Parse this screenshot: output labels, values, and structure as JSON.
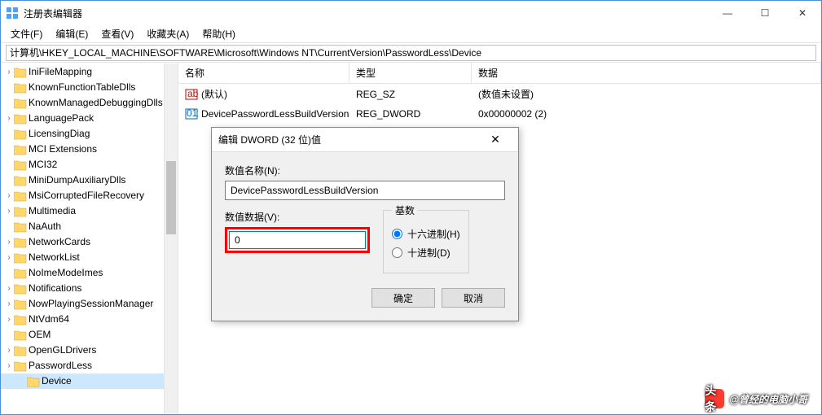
{
  "window": {
    "title": "注册表编辑器",
    "controls": {
      "min": "—",
      "max": "☐",
      "close": "✕"
    }
  },
  "menu": {
    "file": "文件(F)",
    "edit": "编辑(E)",
    "view": "查看(V)",
    "fav": "收藏夹(A)",
    "help": "帮助(H)"
  },
  "path": "计算机\\HKEY_LOCAL_MACHINE\\SOFTWARE\\Microsoft\\Windows NT\\CurrentVersion\\PasswordLess\\Device",
  "tree": {
    "items": [
      {
        "label": "IniFileMapping",
        "expandable": true
      },
      {
        "label": "KnownFunctionTableDlls",
        "expandable": false
      },
      {
        "label": "KnownManagedDebuggingDlls",
        "expandable": false
      },
      {
        "label": "LanguagePack",
        "expandable": true
      },
      {
        "label": "LicensingDiag",
        "expandable": false
      },
      {
        "label": "MCI Extensions",
        "expandable": false
      },
      {
        "label": "MCI32",
        "expandable": false
      },
      {
        "label": "MiniDumpAuxiliaryDlls",
        "expandable": false
      },
      {
        "label": "MsiCorruptedFileRecovery",
        "expandable": true
      },
      {
        "label": "Multimedia",
        "expandable": true
      },
      {
        "label": "NaAuth",
        "expandable": false
      },
      {
        "label": "NetworkCards",
        "expandable": true
      },
      {
        "label": "NetworkList",
        "expandable": true
      },
      {
        "label": "NoImeModeImes",
        "expandable": false
      },
      {
        "label": "Notifications",
        "expandable": true
      },
      {
        "label": "NowPlayingSessionManager",
        "expandable": true
      },
      {
        "label": "NtVdm64",
        "expandable": true
      },
      {
        "label": "OEM",
        "expandable": false
      },
      {
        "label": "OpenGLDrivers",
        "expandable": true
      },
      {
        "label": "PasswordLess",
        "expandable": true
      },
      {
        "label": "Device",
        "expandable": false,
        "selected": true,
        "indent": 1
      }
    ]
  },
  "list": {
    "headers": {
      "name": "名称",
      "type": "类型",
      "data": "数据"
    },
    "rows": [
      {
        "icon": "str",
        "name": "(默认)",
        "type": "REG_SZ",
        "data": "(数值未设置)"
      },
      {
        "icon": "bin",
        "name": "DevicePasswordLessBuildVersion",
        "type": "REG_DWORD",
        "data": "0x00000002 (2)"
      }
    ]
  },
  "dialog": {
    "title": "编辑 DWORD (32 位)值",
    "name_label": "数值名称(N):",
    "name_value": "DevicePasswordLessBuildVersion",
    "data_label": "数值数据(V):",
    "data_value": "0",
    "base_label": "基数",
    "radio_hex": "十六进制(H)",
    "radio_dec": "十进制(D)",
    "ok": "确定",
    "cancel": "取消",
    "close": "✕"
  },
  "watermark": {
    "prefix": "头条",
    "text": "@曾经的电脑小哥"
  }
}
